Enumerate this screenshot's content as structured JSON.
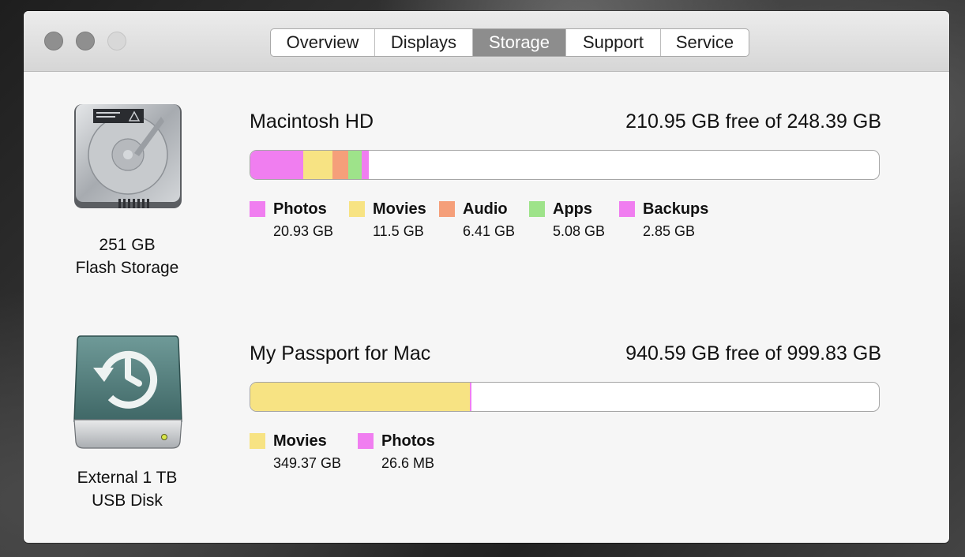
{
  "window": {
    "tabs": [
      {
        "label": "Overview"
      },
      {
        "label": "Displays"
      },
      {
        "label": "Storage"
      },
      {
        "label": "Support"
      },
      {
        "label": "Service"
      }
    ],
    "active_tab": "Storage"
  },
  "disks": [
    {
      "icon": "internal-hard-drive-icon",
      "caption_line1": "251 GB",
      "caption_line2": "Flash Storage",
      "volume_name": "Macintosh HD",
      "free_text": "210.95 GB free of 248.39 GB",
      "categories": [
        {
          "name": "Photos",
          "size": "20.93 GB",
          "color": "#f07ef0"
        },
        {
          "name": "Movies",
          "size": "11.5 GB",
          "color": "#f7e383"
        },
        {
          "name": "Audio",
          "size": "6.41 GB",
          "color": "#f59f7a"
        },
        {
          "name": "Apps",
          "size": "5.08 GB",
          "color": "#9ee38a"
        },
        {
          "name": "Backups",
          "size": "2.85 GB",
          "color": "#f07ef0"
        }
      ]
    },
    {
      "icon": "time-machine-external-drive-icon",
      "caption_line1": "External 1 TB",
      "caption_line2": "USB Disk",
      "volume_name": "My Passport for Mac",
      "free_text": "940.59 GB free of 999.83 GB",
      "categories": [
        {
          "name": "Movies",
          "size": "349.37 GB",
          "color": "#f7e383"
        },
        {
          "name": "Photos",
          "size": "26.6 MB",
          "color": "#f07ef0"
        }
      ]
    }
  ],
  "usage_bars": [
    {
      "segments": [
        {
          "category": "Photos",
          "fraction": 0.0843,
          "color": "#f07ef0"
        },
        {
          "category": "Movies",
          "fraction": 0.0463,
          "color": "#f7e383"
        },
        {
          "category": "Audio",
          "fraction": 0.0258,
          "color": "#f59f7a"
        },
        {
          "category": "Apps",
          "fraction": 0.0205,
          "color": "#9ee38a"
        },
        {
          "category": "Backups",
          "fraction": 0.0115,
          "color": "#f07ef0"
        }
      ]
    },
    {
      "segments": [
        {
          "category": "Movies",
          "fraction": 0.3494,
          "color": "#f7e383"
        },
        {
          "category": "Photos",
          "fraction": 0.003,
          "color": "#f07ef0"
        }
      ]
    }
  ]
}
